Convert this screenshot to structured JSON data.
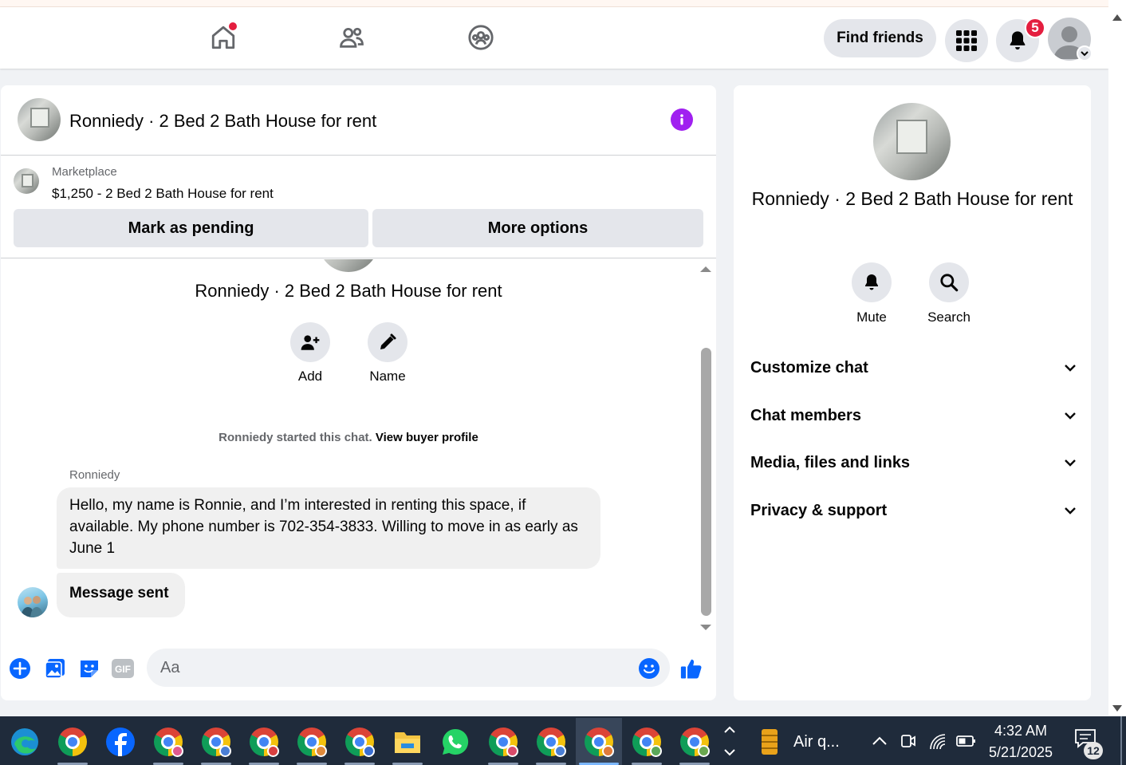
{
  "topnav": {
    "find_friends_label": "Find friends",
    "notification_count": "5"
  },
  "chat": {
    "title": "Ronniedy · 2 Bed 2 Bath House for rent",
    "marketplace_label": "Marketplace",
    "marketplace_item": "$1,250 - 2 Bed 2 Bath House for rent",
    "mark_pending_label": "Mark as pending",
    "more_options_label": "More options",
    "group_name": "Ronniedy · 2 Bed 2 Bath House for rent",
    "add_label": "Add",
    "name_label": "Name",
    "started_text": "Ronniedy started this chat.",
    "view_buyer_label": "View buyer profile",
    "sender": "Ronniedy",
    "message_text": "Hello, my name is Ronnie, and I’m interested in renting this space, if available. My phone number is 702-354-3833. Willing to move in as early as June 1",
    "message_sent_text": "Message sent",
    "composer_placeholder": "Aa"
  },
  "right_panel": {
    "name": "Ronniedy · 2 Bed 2 Bath House for rent",
    "mute_label": "Mute",
    "search_label": "Search",
    "sections": [
      "Customize chat",
      "Chat members",
      "Media, files and links",
      "Privacy & support"
    ]
  },
  "taskbar": {
    "weather_label": "Air q...",
    "time": "4:32 AM",
    "date": "5/21/2025",
    "notification_count": "12"
  },
  "colors": {
    "accent_blue": "#0866ff",
    "info_purple": "#a020f0",
    "badge_red": "#e41e3f"
  }
}
